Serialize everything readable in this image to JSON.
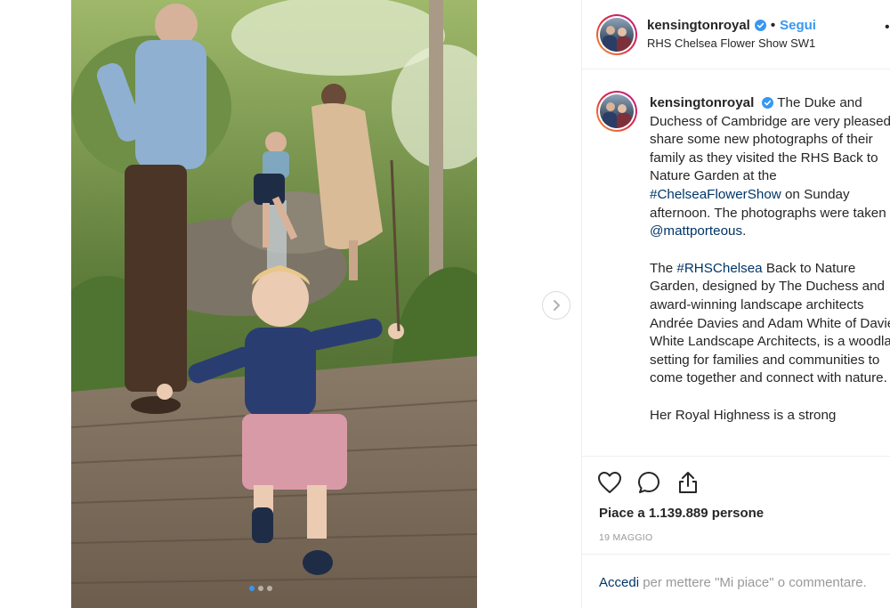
{
  "account": {
    "username": "kensingtonroyal",
    "separator": "•",
    "follow_label": "Segui",
    "location": "RHS Chelsea Flower Show SW1"
  },
  "caption": {
    "username": "kensingtonroyal",
    "p1_text_a": "The Duke and Duchess of Cambridge are very pleased to share some new photographs of their family as they visited the RHS Back to Nature Garden at the ",
    "p1_hashtag": "#ChelseaFlowerShow",
    "p1_text_b": " on Sunday afternoon. The photographs were taken by ",
    "p1_mention": "@mattporteous",
    "p1_text_c": ".",
    "p2_text_a": "The ",
    "p2_hashtag": "#RHSChelsea",
    "p2_text_b": " Back to Nature Garden, designed by The Duchess and award-winning landscape architects Andrée Davies and Adam White of Davies White Landscape Architects, is a woodland setting for families and communities to come together and connect with nature.",
    "p3_text": "Her Royal Highness is a strong"
  },
  "likes_text": "Piace a 1.139.889 persone",
  "date_text": "19 MAGGIO",
  "login": {
    "link_label": "Accedi",
    "rest_text": " per mettere \"Mi piace\" o commentare."
  },
  "icons": {
    "like": "heart-icon",
    "comment": "comment-icon",
    "share": "share-icon",
    "save": "bookmark-icon",
    "next": "chevron-right-icon",
    "verified": "verified-badge-icon"
  },
  "colors": {
    "accent_blue": "#3897f0",
    "link_blue": "#003569",
    "text": "#262626",
    "muted": "#999999",
    "border": "#efefef"
  },
  "carousel": {
    "current": 1,
    "total": 3
  }
}
